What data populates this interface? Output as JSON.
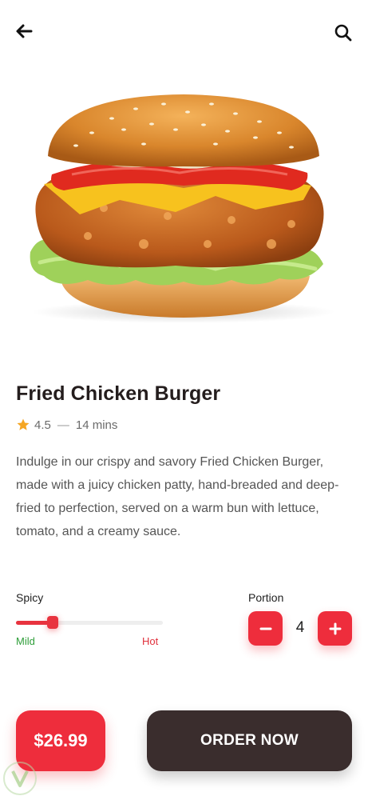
{
  "header": {
    "back_icon": "arrow-left-icon",
    "search_icon": "search-icon"
  },
  "product": {
    "image": "fried-chicken-burger-image",
    "name": "Fried Chicken Burger",
    "rating": "4.5",
    "separator": "—",
    "time": "14 mins",
    "description": "Indulge in our crispy and savory Fried Chicken Burger, made with a juicy chicken patty, hand-breaded and deep-fried to perfection, served on a warm bun with lettuce, tomato, and a creamy sauce."
  },
  "spicy": {
    "label": "Spicy",
    "min_label": "Mild",
    "max_label": "Hot",
    "level": 0.25
  },
  "portion": {
    "label": "Portion",
    "value": "4",
    "minus_icon": "minus-icon",
    "plus_icon": "plus-icon"
  },
  "footer": {
    "price": "$26.99",
    "order_label": "ORDER NOW"
  },
  "colors": {
    "accent": "#ee2d3c",
    "dark": "#3a2d2d",
    "star": "#f5a623",
    "mild": "#2f9e3a"
  }
}
